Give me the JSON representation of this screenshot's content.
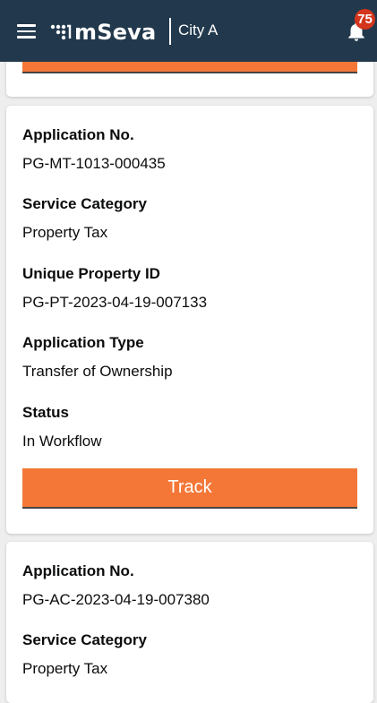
{
  "header": {
    "app_name": "mSeva",
    "city": "City A",
    "notification_count": "75",
    "menu_icon": "hamburger-menu-icon",
    "bell_icon": "bell-icon",
    "bg_color": "#22394d"
  },
  "colors": {
    "primary_button": "#f47738",
    "page_background": "#eeeeee",
    "badge": "#d4351c"
  },
  "applications": [
    {
      "fields": [
        {
          "label": "Application No.",
          "value": "PG-MT-1013-000435"
        },
        {
          "label": "Service Category",
          "value": "Property Tax"
        },
        {
          "label": "Unique Property ID",
          "value": "PG-PT-2023-04-19-007133"
        },
        {
          "label": "Application Type",
          "value": "Transfer of Ownership"
        },
        {
          "label": "Status",
          "value": "In Workflow"
        }
      ],
      "action_label": "Track"
    },
    {
      "fields": [
        {
          "label": "Application No.",
          "value": "PG-AC-2023-04-19-007380"
        },
        {
          "label": "Service Category",
          "value": "Property Tax"
        }
      ]
    }
  ]
}
